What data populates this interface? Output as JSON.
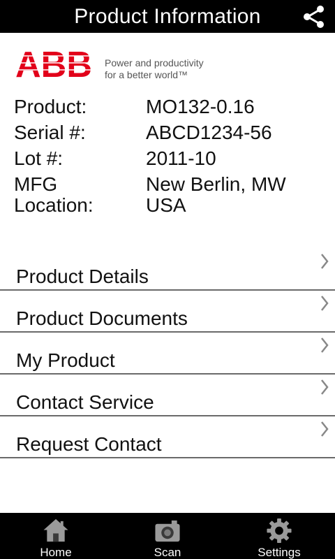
{
  "header": {
    "title": "Product Information",
    "share_icon": "share-icon"
  },
  "brand": {
    "logo_text": "ABB",
    "logo_color": "#E2001A",
    "tagline_line1": "Power and productivity",
    "tagline_line2": "for a better world™"
  },
  "info": {
    "rows": [
      {
        "label": "Product:",
        "value": "MO132-0.16"
      },
      {
        "label": "Serial #:",
        "value": "ABCD1234-56"
      },
      {
        "label": "Lot #:",
        "value": "2011-10"
      },
      {
        "label": "MFG\nLocation:",
        "value": "New Berlin, MW\nUSA"
      }
    ]
  },
  "menu": {
    "items": [
      {
        "label": "Product Details"
      },
      {
        "label": "Product Documents"
      },
      {
        "label": "My Product"
      },
      {
        "label": "Contact Service"
      },
      {
        "label": "Request Contact"
      }
    ]
  },
  "tabbar": {
    "tabs": [
      {
        "label": "Home",
        "icon": "home-icon"
      },
      {
        "label": "Scan",
        "icon": "camera-icon"
      },
      {
        "label": "Settings",
        "icon": "gear-icon"
      }
    ]
  }
}
